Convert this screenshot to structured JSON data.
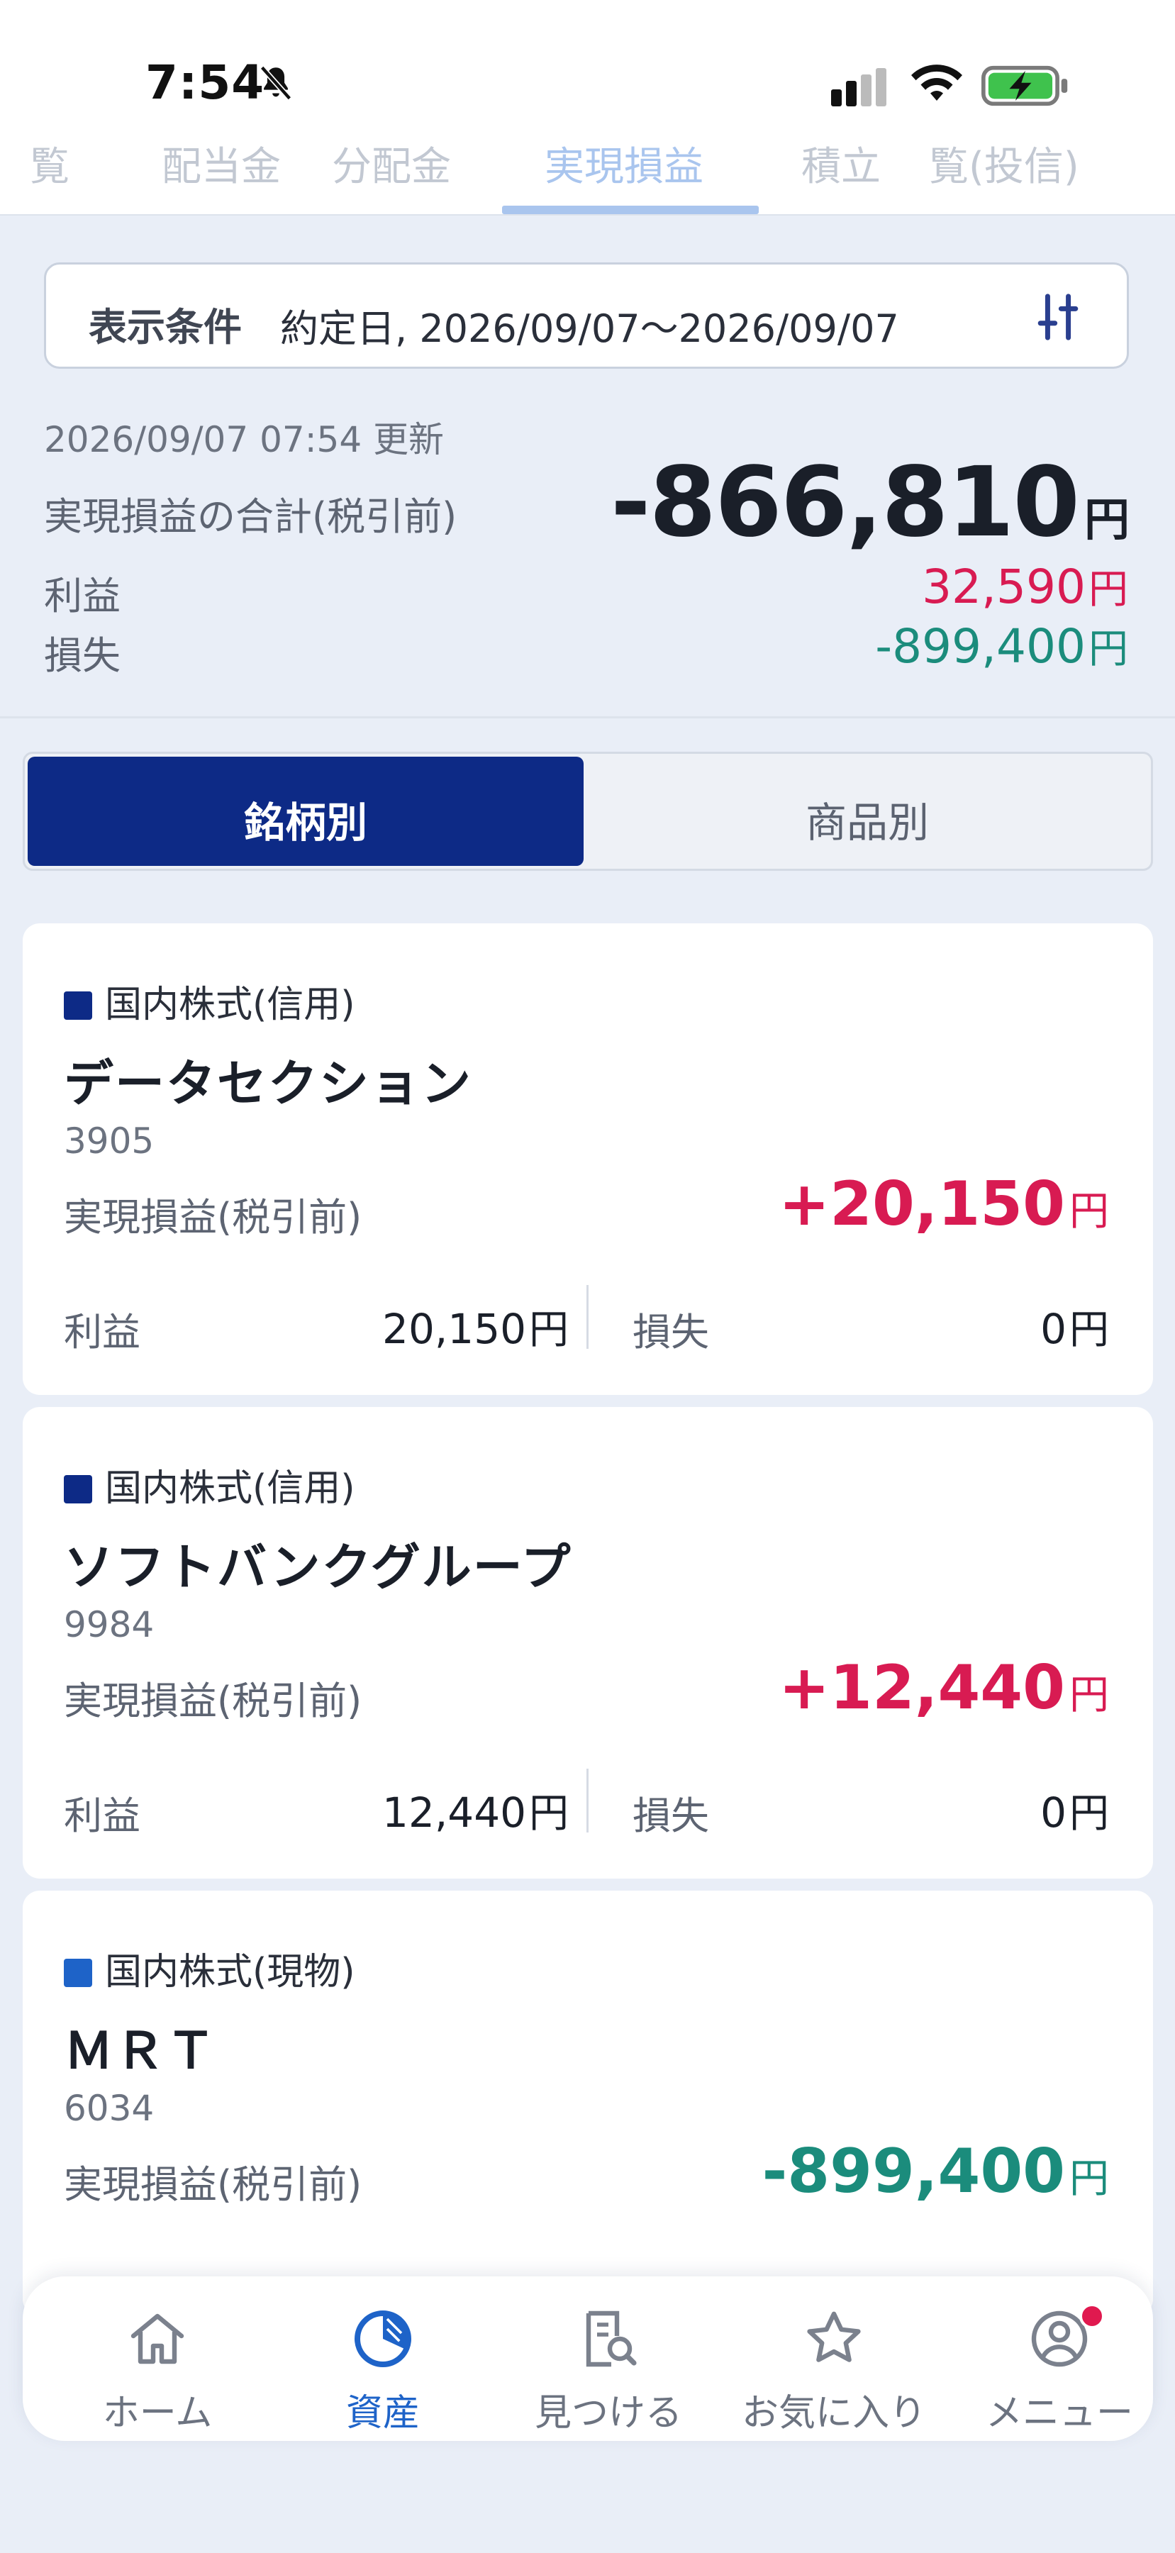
{
  "status_bar": {
    "time": "7:54"
  },
  "top_tabs": [
    {
      "label": "覧"
    },
    {
      "label": "配当金"
    },
    {
      "label": "分配金"
    },
    {
      "label": "実現損益"
    },
    {
      "label": "積立"
    },
    {
      "label": "覧(投信)"
    }
  ],
  "filter": {
    "label": "表示条件",
    "value": "約定日, 2026/09/07〜2026/09/07"
  },
  "summary": {
    "updated": "2026/09/07 07:54 更新",
    "total_label": "実現損益の合計(税引前)",
    "total_value": "-866,810",
    "profit_label": "利益",
    "profit_value": "32,590",
    "loss_label": "損失",
    "loss_value": "-899,400",
    "currency": "円"
  },
  "segment": {
    "active": "銘柄別",
    "inactive": "商品別"
  },
  "cards": [
    {
      "tag": "国内株式(信用)",
      "tag_color": "#0d2a86",
      "name": "データセクション",
      "code": "3905",
      "realized_label": "実現損益(税引前)",
      "realized_value": "+20,150",
      "realized_color": "#d81b52",
      "profit_label": "利益",
      "profit_value": "20,150",
      "loss_label": "損失",
      "loss_value": "0"
    },
    {
      "tag": "国内株式(信用)",
      "tag_color": "#0d2a86",
      "name": "ソフトバンクグループ",
      "code": "9984",
      "realized_label": "実現損益(税引前)",
      "realized_value": "+12,440",
      "realized_color": "#d81b52",
      "profit_label": "利益",
      "profit_value": "12,440",
      "loss_label": "損失",
      "loss_value": "0"
    },
    {
      "tag": "国内株式(現物)",
      "tag_color": "#1e63c8",
      "name": "ＭＲＴ",
      "code": "6034",
      "realized_label": "実現損益(税引前)",
      "realized_value": "-899,400",
      "realized_color": "#1b8c7c"
    }
  ],
  "bottom_nav": [
    {
      "label": "ホーム",
      "icon": "home-icon"
    },
    {
      "label": "資産",
      "icon": "pie-chart-icon",
      "active": true
    },
    {
      "label": "見つける",
      "icon": "search-document-icon"
    },
    {
      "label": "お気に入り",
      "icon": "star-icon"
    },
    {
      "label": "メニュー",
      "icon": "user-icon"
    }
  ],
  "colors": {
    "accent": "#0d2a86",
    "profit": "#d81b52",
    "loss": "#1b8c7c",
    "nav_active": "#1e63c8"
  }
}
